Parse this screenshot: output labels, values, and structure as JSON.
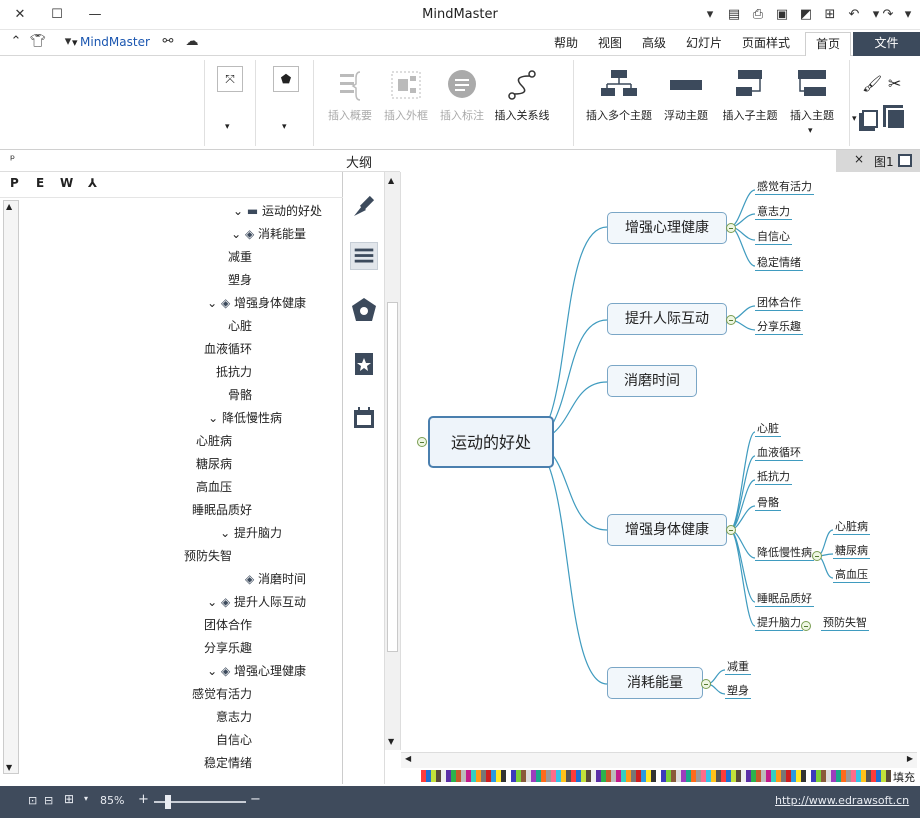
{
  "app": {
    "title": "MindMaster"
  },
  "quick": {
    "brand": "MindMaster"
  },
  "menu": {
    "tabs": [
      "文件",
      "首页",
      "页面样式",
      "幻灯片",
      "高级",
      "视图",
      "帮助"
    ],
    "active": "首页"
  },
  "ribbon": {
    "buttons": [
      {
        "label": "插入主题"
      },
      {
        "label": "插入子主题"
      },
      {
        "label": "浮动主题"
      },
      {
        "label": "插入多个主题"
      },
      {
        "label": "插入关系线"
      },
      {
        "label": "插入标注"
      },
      {
        "label": "插入外框"
      },
      {
        "label": "插入概要"
      }
    ]
  },
  "panel": {
    "outline_title": "大纲",
    "doc_tab": "图1",
    "close": "×",
    "pin": "ᵖ",
    "formats": [
      "P",
      "E",
      "W",
      "⅄"
    ]
  },
  "outline": {
    "rows": [
      {
        "text": "运动的好处",
        "level": 0,
        "icon": "folder",
        "expand": true
      },
      {
        "text": "消耗能量",
        "level": 1,
        "icon": "layers",
        "expand": true
      },
      {
        "text": "减重",
        "level": 2
      },
      {
        "text": "塑身",
        "level": 2
      },
      {
        "text": "增强身体健康",
        "level": 1,
        "icon": "layers",
        "expand": true
      },
      {
        "text": "心脏",
        "level": 2
      },
      {
        "text": "血液循环",
        "level": 2
      },
      {
        "text": "抵抗力",
        "level": 2
      },
      {
        "text": "骨骼",
        "level": 2
      },
      {
        "text": "降低慢性病",
        "level": 2,
        "expand": true
      },
      {
        "text": "心脏病",
        "level": 3
      },
      {
        "text": "糖尿病",
        "level": 3
      },
      {
        "text": "高血压",
        "level": 3
      },
      {
        "text": "睡眠品质好",
        "level": 2
      },
      {
        "text": "提升脑力",
        "level": 2,
        "expand": true
      },
      {
        "text": "预防失智",
        "level": 3
      },
      {
        "text": "消磨时间",
        "level": 1,
        "icon": "layers"
      },
      {
        "text": "提升人际互动",
        "level": 1,
        "icon": "layers",
        "expand": true
      },
      {
        "text": "团体合作",
        "level": 2
      },
      {
        "text": "分享乐趣",
        "level": 2
      },
      {
        "text": "增强心理健康",
        "level": 1,
        "icon": "layers",
        "expand": true
      },
      {
        "text": "感觉有活力",
        "level": 2
      },
      {
        "text": "意志力",
        "level": 2
      },
      {
        "text": "自信心",
        "level": 2
      },
      {
        "text": "稳定情绪",
        "level": 2
      }
    ]
  },
  "mindmap": {
    "root": "运动的好处",
    "mains": [
      "增强心理健康",
      "提升人际互动",
      "消磨时间",
      "增强身体健康",
      "消耗能量"
    ],
    "subs": {
      "mental": [
        "感觉有活力",
        "意志力",
        "自信心",
        "稳定情绪"
      ],
      "social": [
        "团体合作",
        "分享乐趣"
      ],
      "body": [
        "心脏",
        "血液循环",
        "抵抗力",
        "骨骼",
        "降低慢性病",
        "睡眠品质好",
        "提升脑力"
      ],
      "chronic": [
        "心脏病",
        "糖尿病",
        "高血压"
      ],
      "brain": [
        "预防失智"
      ],
      "energy": [
        "减重",
        "塑身"
      ]
    }
  },
  "palette": {
    "label": "填充"
  },
  "status": {
    "url": "http://www.edrawsoft.cn",
    "zoom": "85%",
    "zoom_fraction": 0.85,
    "minus": "−",
    "plus": "+"
  },
  "colors": {
    "file_tab": "#3c4a5c",
    "status": "#3f4b5c",
    "node_border": "#7aa6c6",
    "link": "#3f9bbf"
  }
}
